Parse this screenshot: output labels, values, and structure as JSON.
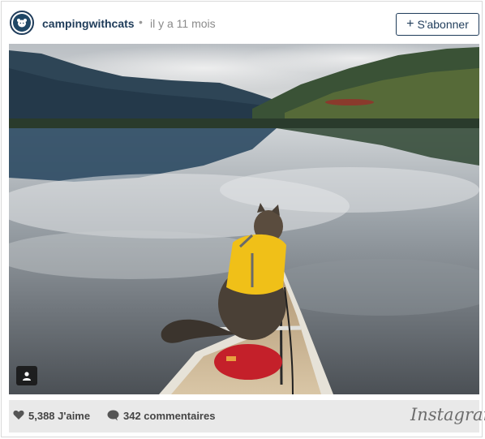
{
  "post": {
    "username": "campingwithcats",
    "separator": "•",
    "time": "il y a 11 mois",
    "follow_label": "S'abonner",
    "likes": "5,388 J'aime",
    "comments": "342 commentaires",
    "brand": "Instagram"
  },
  "icons": {
    "avatar": "bear-logo-icon",
    "follow": "plus-icon",
    "badge": "user-icon",
    "likes": "heart-icon",
    "comments": "comment-bubble-icon"
  },
  "colors": {
    "accent": "#1f3c5a",
    "footer_bg": "#e9e9e9",
    "muted_text": "#8a8a8a"
  }
}
